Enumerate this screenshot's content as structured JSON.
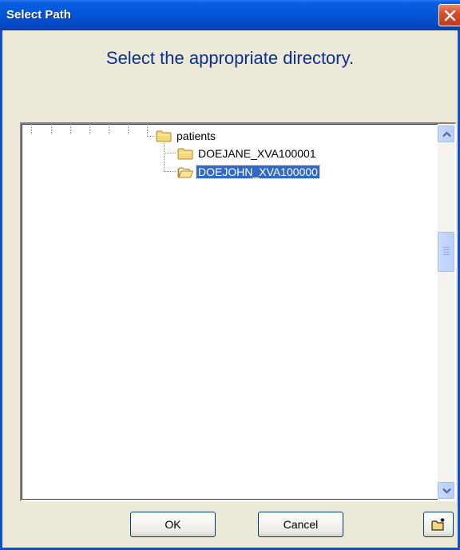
{
  "window": {
    "title": "Select Path"
  },
  "heading": "Select the appropriate directory.",
  "tree": {
    "nodes": [
      {
        "label": "patients",
        "icon": "folder-icon",
        "selected": false
      },
      {
        "label": "DOEJANE_XVA100001",
        "icon": "folder-icon",
        "selected": false
      },
      {
        "label": "DOEJOHN_XVA100000",
        "icon": "folder-open-icon",
        "selected": true
      }
    ]
  },
  "buttons": {
    "ok_label": "OK",
    "cancel_label": "Cancel",
    "new_folder_icon": "new-folder-icon"
  },
  "colors": {
    "titlebar": "#0554d8",
    "heading": "#0b2f8f",
    "selection": "#316ac5",
    "folder": "#f5d77a"
  },
  "scroll": {
    "position_fraction": 0.35
  }
}
